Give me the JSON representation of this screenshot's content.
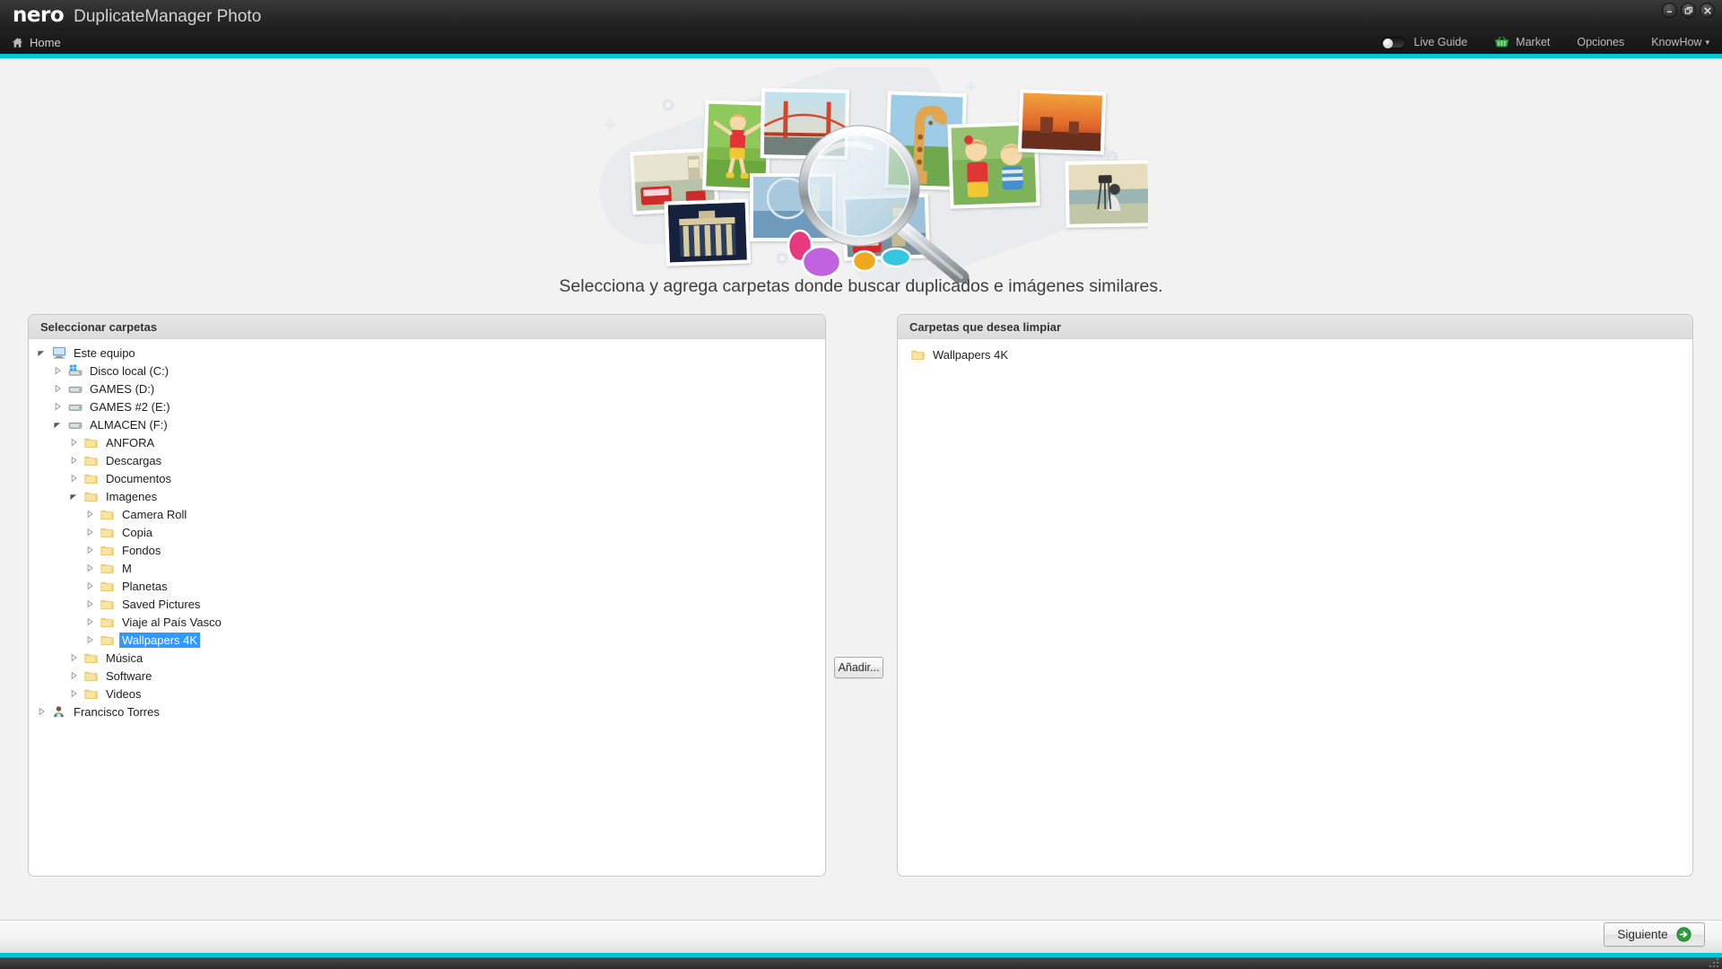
{
  "window": {
    "brand": "nero",
    "app_title": "DuplicateManager Photo",
    "controls": [
      {
        "name": "minimize-button",
        "glyph": "minimize-icon"
      },
      {
        "name": "restore-button",
        "glyph": "restore-icon"
      },
      {
        "name": "close-button",
        "glyph": "close-icon"
      }
    ]
  },
  "menubar": {
    "home_label": "Home",
    "home_icon": "home-icon",
    "live_guide_label": "Live Guide",
    "live_guide_on": false,
    "market_label": "Market",
    "market_icon": "shopping-basket-icon",
    "options_label": "Opciones",
    "knowhow_label": "KnowHow",
    "knowhow_caret": "▾"
  },
  "theme": {
    "accent": "#00c9d0",
    "selection": "#3399ff",
    "folder": "#f5ce6b",
    "titlebar_dark": "#2c2c2c"
  },
  "hero": {
    "alt": "photo-collage-with-magnifier-illustration"
  },
  "main": {
    "headline": "Selecciona y agrega carpetas donde buscar duplicados e imágenes similares."
  },
  "left_panel": {
    "title": "Seleccionar carpetas",
    "tree": [
      {
        "label": "Este equipo",
        "depth": 0,
        "icon": "computer-icon",
        "twist": "expanded",
        "selected": false
      },
      {
        "label": "Disco local (C:)",
        "depth": 1,
        "icon": "windows-drive-icon",
        "twist": "collapsed",
        "selected": false
      },
      {
        "label": "GAMES (D:)",
        "depth": 1,
        "icon": "drive-icon",
        "twist": "collapsed",
        "selected": false
      },
      {
        "label": "GAMES #2 (E:)",
        "depth": 1,
        "icon": "drive-icon",
        "twist": "collapsed",
        "selected": false
      },
      {
        "label": "ALMACEN (F:)",
        "depth": 1,
        "icon": "drive-icon",
        "twist": "expanded",
        "selected": false
      },
      {
        "label": "ANFORA",
        "depth": 2,
        "icon": "folder-icon",
        "twist": "collapsed",
        "selected": false
      },
      {
        "label": "Descargas",
        "depth": 2,
        "icon": "folder-icon",
        "twist": "collapsed",
        "selected": false
      },
      {
        "label": "Documentos",
        "depth": 2,
        "icon": "folder-icon",
        "twist": "collapsed",
        "selected": false
      },
      {
        "label": "Imagenes",
        "depth": 2,
        "icon": "folder-icon",
        "twist": "expanded",
        "selected": false
      },
      {
        "label": "Camera Roll",
        "depth": 3,
        "icon": "folder-icon",
        "twist": "collapsed",
        "selected": false
      },
      {
        "label": "Copia",
        "depth": 3,
        "icon": "folder-icon",
        "twist": "collapsed",
        "selected": false
      },
      {
        "label": "Fondos",
        "depth": 3,
        "icon": "folder-icon",
        "twist": "collapsed",
        "selected": false
      },
      {
        "label": "M",
        "depth": 3,
        "icon": "folder-icon",
        "twist": "collapsed",
        "selected": false
      },
      {
        "label": "Planetas",
        "depth": 3,
        "icon": "folder-icon",
        "twist": "collapsed",
        "selected": false
      },
      {
        "label": "Saved Pictures",
        "depth": 3,
        "icon": "folder-icon",
        "twist": "collapsed",
        "selected": false
      },
      {
        "label": "Viaje al País Vasco",
        "depth": 3,
        "icon": "folder-icon",
        "twist": "collapsed",
        "selected": false
      },
      {
        "label": "Wallpapers 4K",
        "depth": 3,
        "icon": "folder-icon",
        "twist": "collapsed",
        "selected": true
      },
      {
        "label": "Música",
        "depth": 2,
        "icon": "folder-icon",
        "twist": "collapsed",
        "selected": false
      },
      {
        "label": "Software",
        "depth": 2,
        "icon": "folder-icon",
        "twist": "collapsed",
        "selected": false
      },
      {
        "label": "Videos",
        "depth": 2,
        "icon": "folder-icon",
        "twist": "collapsed",
        "selected": false
      },
      {
        "label": "Francisco Torres",
        "depth": 0,
        "icon": "user-icon",
        "twist": "collapsed",
        "selected": false
      }
    ]
  },
  "add_button": {
    "label": "Añadir..."
  },
  "right_panel": {
    "title": "Carpetas que desea limpiar",
    "items": [
      {
        "label": "Wallpapers 4K",
        "icon": "folder-icon"
      }
    ]
  },
  "footer": {
    "next_label": "Siguiente",
    "next_icon": "arrow-right-circle-icon"
  }
}
